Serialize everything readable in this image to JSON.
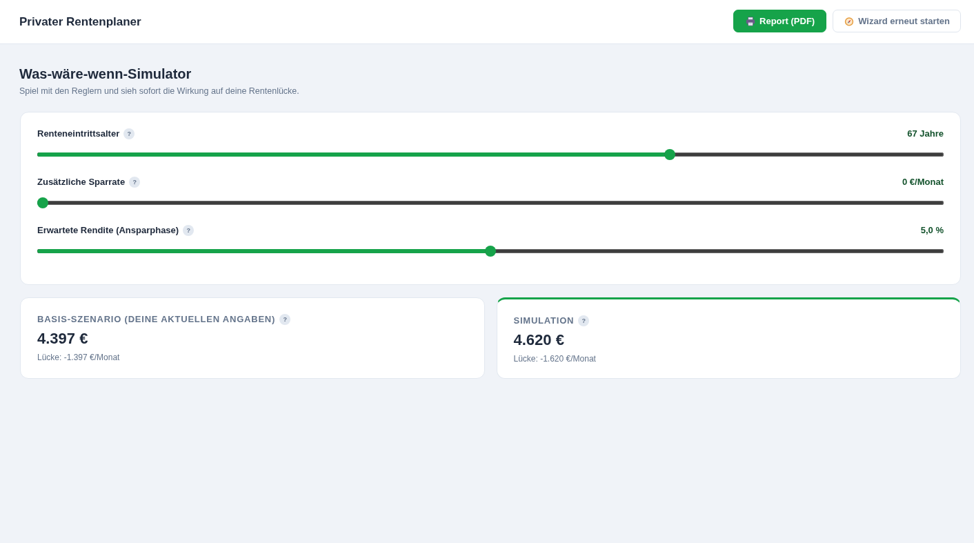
{
  "header": {
    "title": "Privater Rentenplaner",
    "buttons": [
      {
        "label": "Report (PDF)",
        "kind": "primary"
      },
      {
        "label": "Wizard erneut starten",
        "kind": "secondary"
      }
    ]
  },
  "simulator": {
    "title": "Was-wäre-wenn-Simulator",
    "subtitle": "Spiel mit den Reglern und sieh sofort die Wirkung auf deine Rentenlücke."
  },
  "sliders": [
    {
      "label": "Renteneintrittsalter",
      "help": "?",
      "reading": "67 Jahre",
      "level": 0.7
    },
    {
      "label": "Zusätzliche Sparrate",
      "help": "?",
      "reading": "0 €/Monat",
      "level": 0
    },
    {
      "label": "Erwartete Rendite (Ansparphase)",
      "help": "?",
      "reading": "5,0 %",
      "level": 0.5
    }
  ],
  "scenarios": [
    {
      "title": "BASIS-SZENARIO (DEINE AKTUELLEN ANGABEN)",
      "help": "?",
      "amount": "4.397 €",
      "gap": "Lücke: -1.397 €/Monat",
      "highlighted": false
    },
    {
      "title": "SIMULATION",
      "help": "?",
      "amount": "4.620 €",
      "gap": "Lücke: -1.620 €/Monat",
      "highlighted": true
    }
  ]
}
